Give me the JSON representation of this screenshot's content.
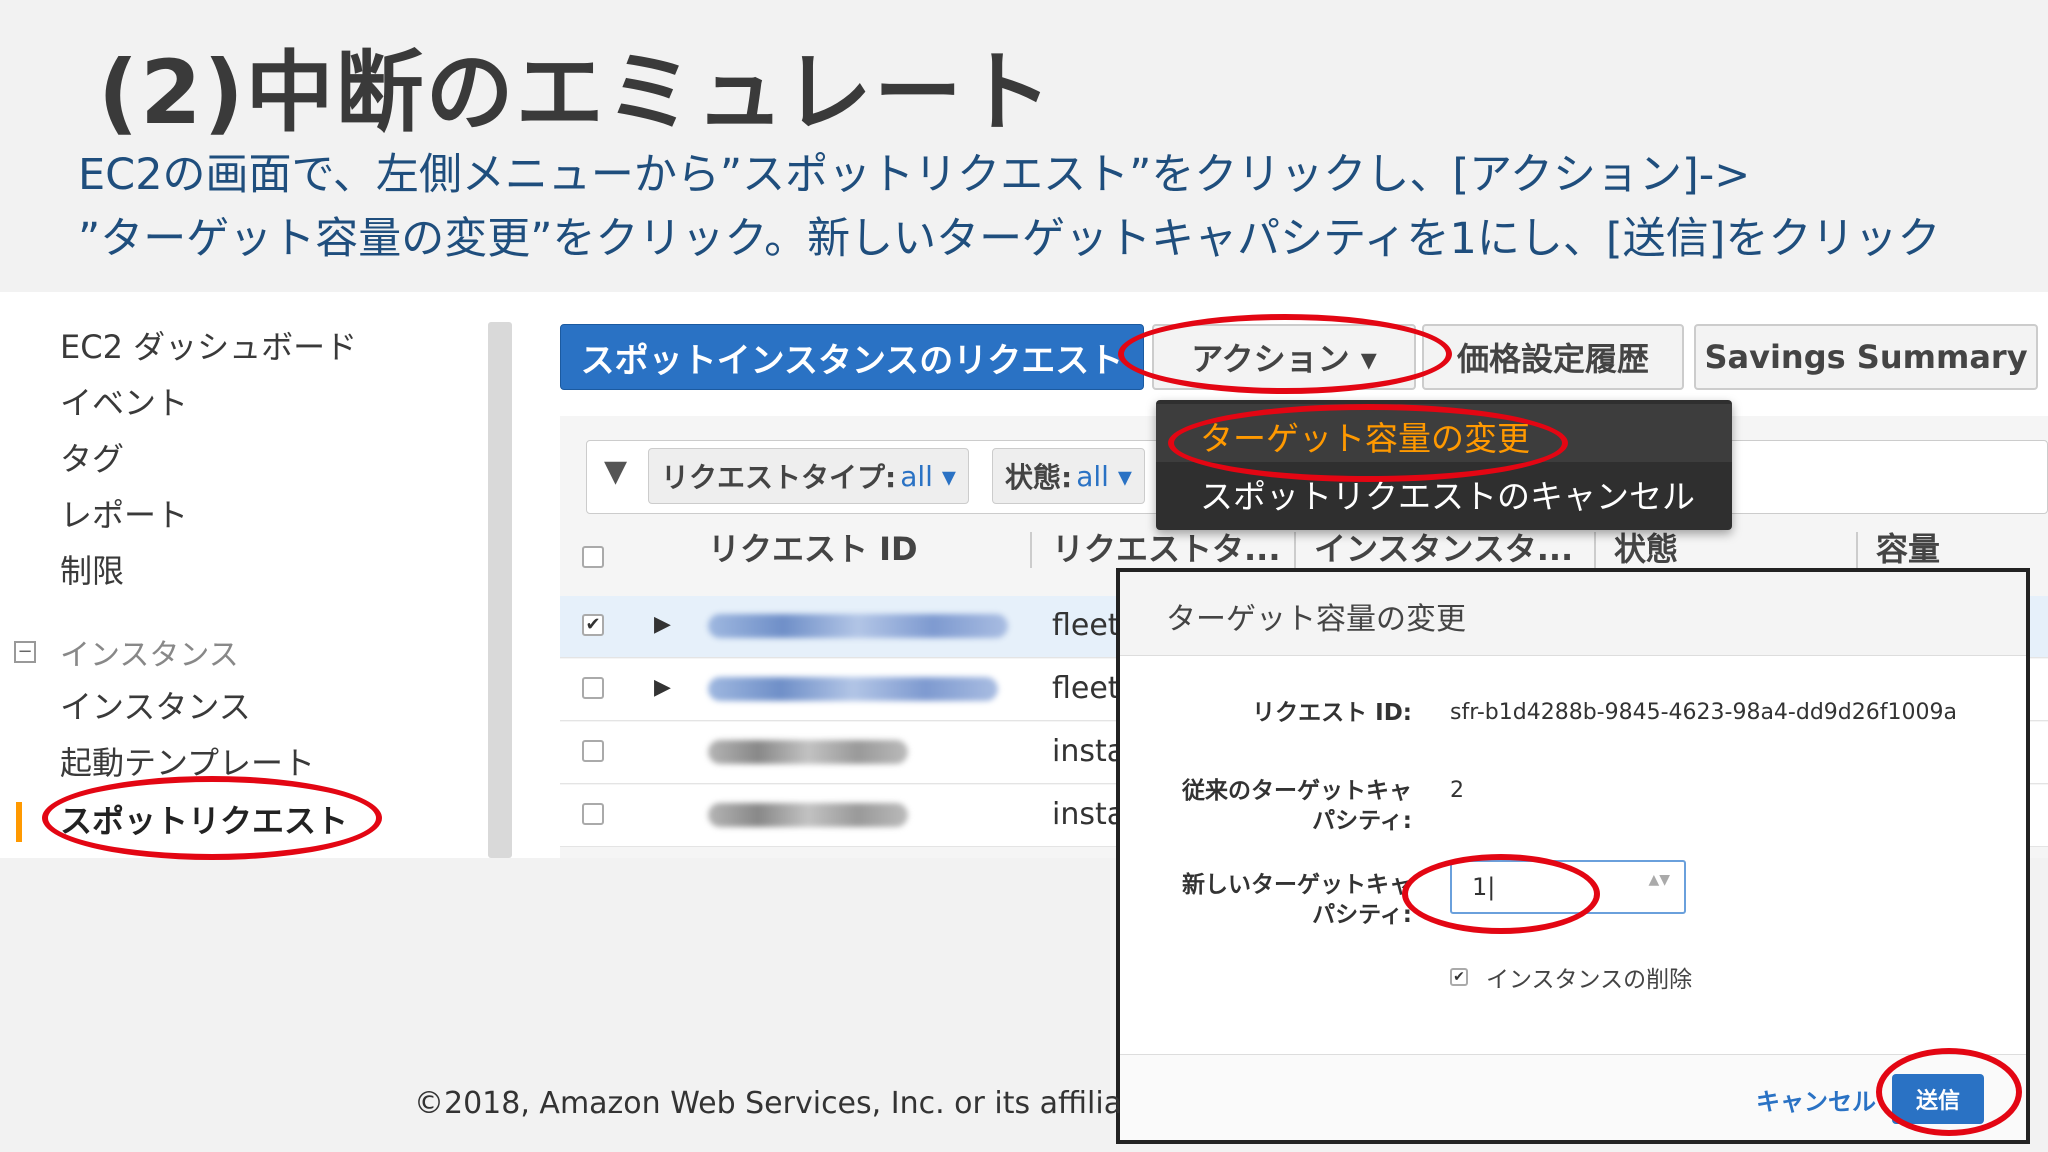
{
  "slide": {
    "title": "(2)中断のエミュレート",
    "line1": "EC2の画面で、左側メニューから”スポットリクエスト”をクリックし、[アクション]->",
    "line2": "”ターゲット容量の変更”をクリック。新しいターゲットキャパシティを1にし、[送信]をクリック",
    "copyright": "©2018, Amazon Web Services, Inc. or its affilia"
  },
  "sidebar": {
    "items": [
      "EC2 ダッシュボード",
      "イベント",
      "タグ",
      "レポート",
      "制限"
    ],
    "section": {
      "label": "インスタンス",
      "collapse": "−"
    },
    "subitems": [
      "インスタンス",
      "起動テンプレート",
      "スポットリクエスト"
    ]
  },
  "toolbar": {
    "primary": "スポットインスタンスのリクエスト",
    "actions": "アクション ▾",
    "price_history": "価格設定履歴",
    "savings": "Savings Summary"
  },
  "dropdown": {
    "items": [
      "ターゲット容量の変更",
      "スポットリクエストのキャンセル"
    ]
  },
  "filters": {
    "icon": "▼",
    "type_label": "リクエストタイプ:",
    "type_value": "all ▾",
    "state_label": "状態:",
    "state_value": "all ▾"
  },
  "table": {
    "headers": [
      "リクエスト ID",
      "リクエストタ...",
      "インスタンスタ...",
      "状態",
      "容量"
    ],
    "rows": [
      {
        "checked": true,
        "expandable": true,
        "type": "fleet"
      },
      {
        "checked": false,
        "expandable": true,
        "type": "fleet"
      },
      {
        "checked": false,
        "expandable": false,
        "type": "insta"
      },
      {
        "checked": false,
        "expandable": false,
        "type": "insta"
      }
    ]
  },
  "modal": {
    "title": "ターゲット容量の変更",
    "request_id_label": "リクエスト ID:",
    "request_id_value": "sfr-b1d4288b-9845-4623-98a4-dd9d26f1009a",
    "old_capacity_label_1": "従来のターゲットキャ",
    "old_capacity_label_2": "パシティ:",
    "old_capacity_value": "2",
    "new_capacity_label_1": "新しいターゲットキャ",
    "new_capacity_label_2": "パシティ:",
    "new_capacity_value": "1|",
    "terminate_label": "インスタンスの削除",
    "cancel": "キャンセル",
    "submit": "送信"
  },
  "icons": {
    "check": "✔",
    "expand": "▶",
    "spin": "▲▼"
  },
  "colors": {
    "primary": "#2a72c4",
    "active": "#ff9900",
    "annotation": "#e30613",
    "subtitle": "#1f4e7d"
  }
}
